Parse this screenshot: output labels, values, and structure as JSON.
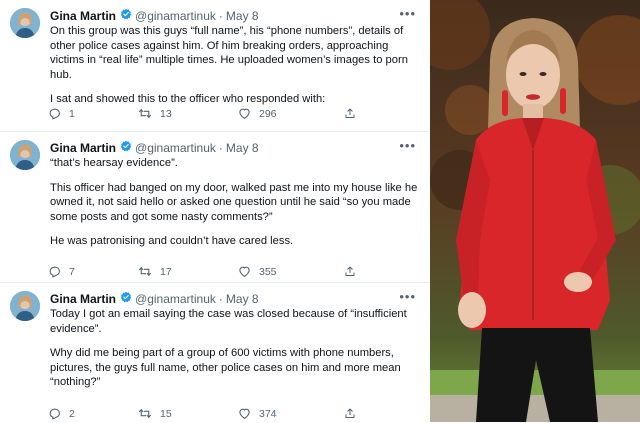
{
  "tweets": [
    {
      "name": "Gina Martin",
      "handle": "@ginamartinuk",
      "date": "May 8",
      "paragraphs": [
        "On this group was this guys “full name”, his “phone numbers”, details of other police cases against him. Of him breaking orders, approaching victims in “real life” multiple times. He uploaded women’s images to porn hub.",
        "I sat and showed this to the officer who responded with:"
      ],
      "replies": "1",
      "retweets": "13",
      "likes": "296"
    },
    {
      "name": "Gina Martin",
      "handle": "@ginamartinuk",
      "date": "May 8",
      "paragraphs": [
        "“that’s hearsay evidence”.",
        "This officer had banged on my door, walked past me into my house like he owned it, not said hello or asked one question until he said “so you made some posts and got some nasty comments?”",
        "He was patronising and couldn’t have cared less."
      ],
      "replies": "7",
      "retweets": "17",
      "likes": "355"
    },
    {
      "name": "Gina Martin",
      "handle": "@ginamartinuk",
      "date": "May 8",
      "paragraphs": [
        "Today I got an email saying the case was closed because of “insufficient evidence”.",
        "Why did me being part of a group of 600 victims with phone numbers, pictures, the guys full name, other police cases on him and more mean “nothing?”"
      ],
      "replies": "2",
      "retweets": "15",
      "likes": "374"
    }
  ],
  "icons": {
    "verified": "verified-badge-icon",
    "more": "more-options-icon",
    "reply": "reply-icon",
    "retweet": "retweet-icon",
    "like": "heart-icon",
    "share": "share-icon"
  },
  "colors": {
    "verified": "#1d9bf0",
    "text": "#0f1419",
    "muted": "#536471",
    "shirt": "#d8262b"
  }
}
